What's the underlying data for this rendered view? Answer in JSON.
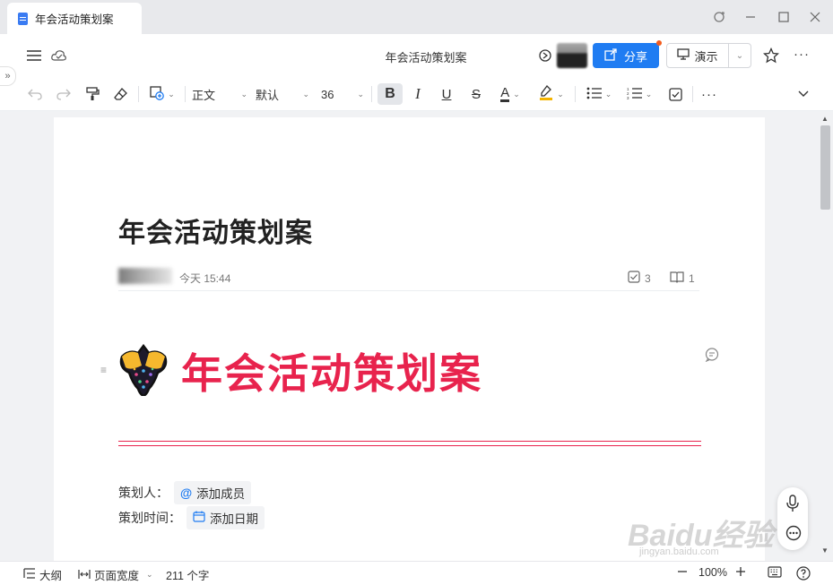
{
  "window": {
    "tab_title": "年会活动策划案",
    "controls": [
      "refresh-icon",
      "minimize-icon",
      "maximize-icon",
      "close-icon"
    ]
  },
  "header": {
    "doc_title": "年会活动策划案",
    "share_label": "分享",
    "present_label": "演示",
    "more_label": "···"
  },
  "toolbar": {
    "paragraph_style": "正文",
    "font_family": "默认",
    "font_size": "36",
    "more_label": "···"
  },
  "document": {
    "title": "年会活动策划案",
    "meta": {
      "time": "今天 15:44",
      "tasks_count": "3",
      "reads_count": "1"
    },
    "heading": "年会活动策划案",
    "fields": [
      {
        "label": "策划人：",
        "chip": "添加成员"
      },
      {
        "label": "策划时间：",
        "chip": "添加日期"
      }
    ]
  },
  "statusbar": {
    "outline_label": "大纲",
    "page_width_label": "页面宽度",
    "word_count": "211 个字",
    "zoom": "100%"
  },
  "watermark": {
    "main": "Baidu经验",
    "sub": "jingyan.baidu.com"
  },
  "colors": {
    "accent": "#1f7cf2",
    "heading_red": "#e8234d",
    "notify_dot": "#f35b1c"
  }
}
